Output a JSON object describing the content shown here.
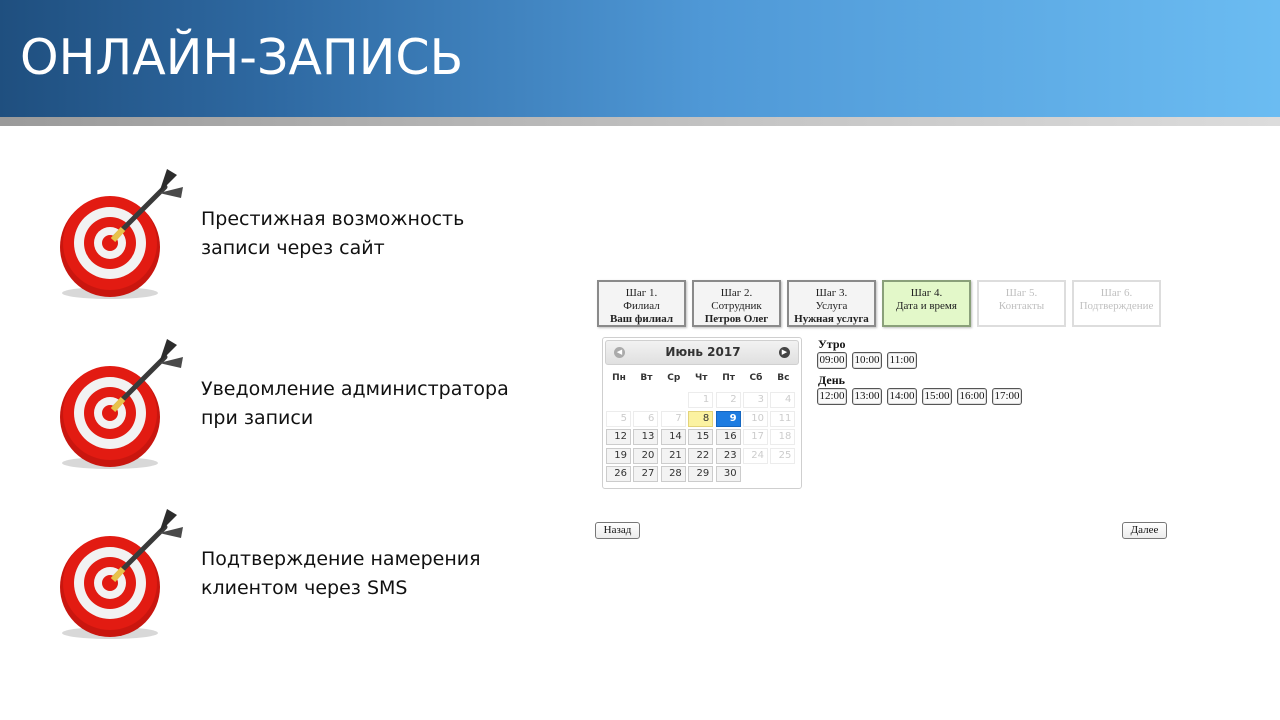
{
  "header": {
    "title": "ОНЛАЙН-ЗАПИСЬ"
  },
  "features": [
    {
      "line1": "Престижная возможность",
      "line2": "записи через сайт",
      "icon": "target-icon"
    },
    {
      "line1": "Уведомление администратора",
      "line2": "при записи",
      "icon": "target-icon"
    },
    {
      "line1": "Подтверждение намерения",
      "line2": "клиентом через SMS",
      "icon": "target-icon"
    }
  ],
  "widget": {
    "steps": [
      {
        "step": "Шаг 1.",
        "name": "Филиал",
        "value": "Ваш филиал",
        "state": "done"
      },
      {
        "step": "Шаг 2.",
        "name": "Сотрудник",
        "value": "Петров Олег",
        "state": "done"
      },
      {
        "step": "Шаг 3.",
        "name": "Услуга",
        "value": "Нужная услуга",
        "state": "done"
      },
      {
        "step": "Шаг 4.",
        "name": "Дата и время",
        "value": "",
        "state": "active"
      },
      {
        "step": "Шаг 5.",
        "name": "Контакты",
        "value": "",
        "state": "disabled"
      },
      {
        "step": "Шаг 6.",
        "name": "Подтверждение",
        "value": "",
        "state": "disabled"
      }
    ],
    "calendar": {
      "title": "Июнь 2017",
      "weekdays": [
        "Пн",
        "Вт",
        "Ср",
        "Чт",
        "Пт",
        "Сб",
        "Вс"
      ],
      "weeks": [
        [
          null,
          null,
          null,
          {
            "d": "1",
            "s": "other"
          },
          {
            "d": "2",
            "s": "other"
          },
          {
            "d": "3",
            "s": "other"
          },
          {
            "d": "4",
            "s": "other"
          }
        ],
        [
          {
            "d": "5",
            "s": "other"
          },
          {
            "d": "6",
            "s": "other"
          },
          {
            "d": "7",
            "s": "other"
          },
          {
            "d": "8",
            "s": "today"
          },
          {
            "d": "9",
            "s": "sel"
          },
          {
            "d": "10",
            "s": "other"
          },
          {
            "d": "11",
            "s": "other"
          }
        ],
        [
          {
            "d": "12",
            "s": ""
          },
          {
            "d": "13",
            "s": ""
          },
          {
            "d": "14",
            "s": ""
          },
          {
            "d": "15",
            "s": ""
          },
          {
            "d": "16",
            "s": ""
          },
          {
            "d": "17",
            "s": "other"
          },
          {
            "d": "18",
            "s": "other"
          }
        ],
        [
          {
            "d": "19",
            "s": ""
          },
          {
            "d": "20",
            "s": ""
          },
          {
            "d": "21",
            "s": ""
          },
          {
            "d": "22",
            "s": ""
          },
          {
            "d": "23",
            "s": ""
          },
          {
            "d": "24",
            "s": "other"
          },
          {
            "d": "25",
            "s": "other"
          }
        ],
        [
          {
            "d": "26",
            "s": ""
          },
          {
            "d": "27",
            "s": ""
          },
          {
            "d": "28",
            "s": ""
          },
          {
            "d": "29",
            "s": ""
          },
          {
            "d": "30",
            "s": ""
          },
          null,
          null
        ]
      ]
    },
    "times": {
      "morning_label": "Утро",
      "morning": [
        "09:00",
        "10:00",
        "11:00"
      ],
      "day_label": "День",
      "day": [
        "12:00",
        "13:00",
        "14:00",
        "15:00",
        "16:00",
        "17:00"
      ]
    },
    "back_label": "Назад",
    "next_label": "Далее"
  },
  "colors": {
    "active_step": "#e3f8c9",
    "selected_day": "#1d7ce1",
    "today": "#fbf2a1",
    "banner_start": "#1f4f7f",
    "banner_end": "#6bbcf2"
  }
}
